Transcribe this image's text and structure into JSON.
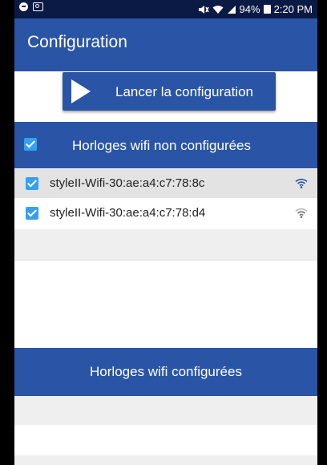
{
  "status_bar": {
    "battery": "94%",
    "time": "2:20 PM"
  },
  "app_bar": {
    "title": "Configuration"
  },
  "launch_button": {
    "label": "Lancer la configuration"
  },
  "unconfigured_section": {
    "title": "Horloges wifi non configurées",
    "select_all_checked": true,
    "items": [
      {
        "name": "styleII-Wifi-30:ae:a4:c7:78:8c",
        "checked": true,
        "signal": "strong"
      },
      {
        "name": "styleII-Wifi-30:ae:a4:c7:78:d4",
        "checked": true,
        "signal": "medium"
      }
    ]
  },
  "configured_section": {
    "title": "Horloges wifi configurées"
  },
  "colors": {
    "status_bar": "#0b1a44",
    "primary": "#2a55a6",
    "checkbox": "#37a0ee",
    "selected_row": "#e3e3e3"
  }
}
